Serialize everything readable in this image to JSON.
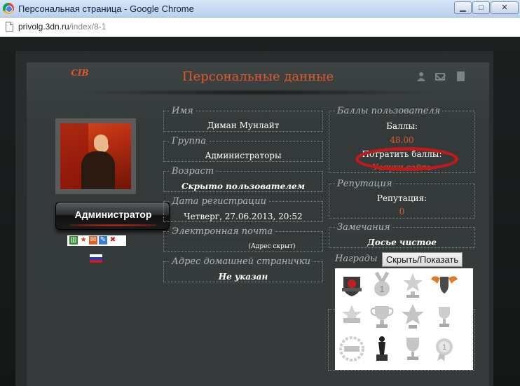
{
  "window": {
    "title": "Персональная страница - Google Chrome",
    "minimize": "▁",
    "maximize": "□",
    "close": "✕"
  },
  "address": {
    "host": "privolg.3dn.ru",
    "path": "/index/8-1"
  },
  "panel": {
    "title": "Персональные данные",
    "icons": [
      "user-icon",
      "mail-icon",
      "document-icon"
    ]
  },
  "profile": {
    "nick": "CIB",
    "group_badge": "Администратор",
    "tool_icons": [
      "stats-icon",
      "star-icon",
      "message-icon",
      "edit-icon",
      "delete-icon"
    ]
  },
  "fields": {
    "name": {
      "label": "Имя",
      "value": "Диман Мунлайт"
    },
    "group": {
      "label": "Группа",
      "value": "Администраторы"
    },
    "age": {
      "label": "Возраст",
      "value": "Скрыто пользователем"
    },
    "registered": {
      "label": "Дата регистрации",
      "value": "Четверг, 27.06.2013, 20:52"
    },
    "email": {
      "label": "Электронная почта",
      "value": "(Адрес скрыт)"
    },
    "homepage": {
      "label": "Адрес домашней странички",
      "value": "Не указан"
    }
  },
  "points": {
    "label": "Баллы пользователя",
    "points_label": "Баллы:",
    "points_value": "48.00",
    "spend_label": "Потратить баллы:",
    "spend_link": "Услуги сайта"
  },
  "reputation": {
    "label": "Репутация",
    "rep_label": "Репутация:",
    "rep_value": "0"
  },
  "remarks": {
    "label": "Замечания",
    "value": "Досье чистое"
  },
  "awards": {
    "label": "Награды",
    "toggle": "Скрыть/Показать",
    "items": [
      "shield-award-icon",
      "medal-award-icon",
      "trophy-star-award-icon",
      "winged-shield-award-icon",
      "star-badge-award-icon",
      "cup-award-icon",
      "star-trophy-award-icon",
      "small-cup-award-icon",
      "laurel-badge-award-icon",
      "oscar-statue-award-icon",
      "gold-cup-award-icon",
      "ribbon-medal-award-icon"
    ]
  },
  "colors": {
    "accent": "#e0582a",
    "highlight": "#c01a1a"
  }
}
